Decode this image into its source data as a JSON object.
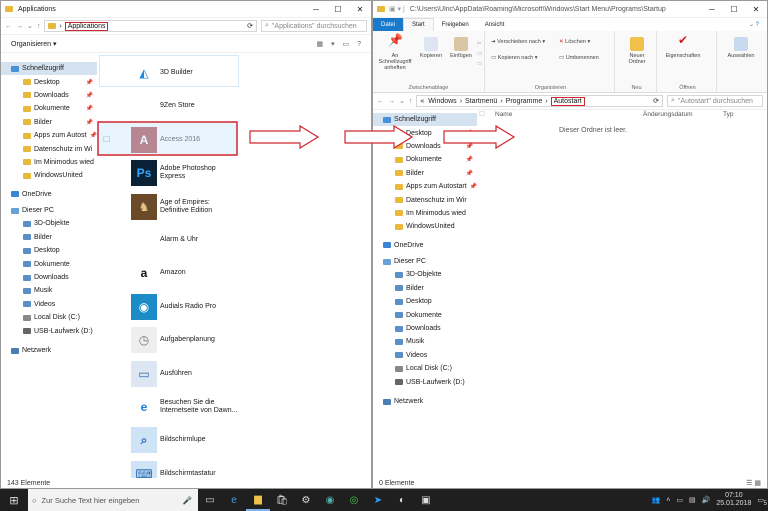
{
  "left_window": {
    "title": "Applications",
    "address": "Applications",
    "search_placeholder": "\"Applications\" durchsuchen",
    "organize_label": "Organisieren",
    "status": "143 Elemente",
    "nav": [
      "Schnellzugriff",
      "Desktop",
      "Downloads",
      "Dokumente",
      "Bilder",
      "Apps zum Autost",
      "Datenschutz im Wi",
      "Im Minimodus wied",
      "WindowsUnited",
      "OneDrive",
      "Dieser PC",
      "3D-Objekte",
      "Bilder",
      "Desktop",
      "Dokumente",
      "Downloads",
      "Musik",
      "Videos",
      "Local Disk (C:)",
      "USB-Laufwerk (D:)",
      "Netzwerk"
    ],
    "apps": [
      {
        "line1": "3D Builder",
        "line2": ""
      },
      {
        "line1": "9Zen Store",
        "line2": ""
      },
      {
        "line1": "Access 2016",
        "line2": ""
      },
      {
        "line1": "Adobe Photoshop",
        "line2": "Express"
      },
      {
        "line1": "Age of Empires:",
        "line2": "Definitive Edition"
      },
      {
        "line1": "Alarm & Uhr",
        "line2": ""
      },
      {
        "line1": "Amazon",
        "line2": ""
      },
      {
        "line1": "Audials Radio Pro",
        "line2": ""
      },
      {
        "line1": "Aufgabenplanung",
        "line2": ""
      },
      {
        "line1": "Ausführen",
        "line2": ""
      },
      {
        "line1": "Besuchen Sie die",
        "line2": "Internetseite von Dawn..."
      },
      {
        "line1": "Bildschirmlupe",
        "line2": ""
      },
      {
        "line1": "Bildschirmtastatur",
        "line2": ""
      }
    ]
  },
  "right_window": {
    "title_path": "C:\\Users\\Ulric\\AppData\\Roaming\\Microsoft\\Windows\\Start Menu\\Programs\\Startup",
    "tabs": [
      "Datei",
      "Start",
      "Freigeben",
      "Ansicht"
    ],
    "ribbon": {
      "pin": "An Schnellzugriff anheften",
      "copy": "Kopieren",
      "paste": "Einfügen",
      "clipboard_group": "Zwischenablage",
      "move_to": "Verschieben nach",
      "copy_to": "Kopieren nach",
      "delete": "Löschen",
      "rename": "Umbenennen",
      "organize_group": "Organisieren",
      "new_folder": "Neuer Ordner",
      "new_group": "Neu",
      "properties": "Eigenschaften",
      "open_group": "Öffnen",
      "select": "Auswählen"
    },
    "breadcrumb": [
      "Windows",
      "Startmenü",
      "Programme",
      "Autostart"
    ],
    "search_placeholder": "\"Autostart\" durchsuchen",
    "columns": [
      "Name",
      "Änderungsdatum",
      "Typ"
    ],
    "empty_message": "Dieser Ordner ist leer.",
    "status": "0 Elemente",
    "nav": [
      "Schnellzugriff",
      "Desktop",
      "Downloads",
      "Dokumente",
      "Bilder",
      "Apps zum Autostart",
      "Datenschutz im Wir",
      "Im Minimodus wied",
      "WindowsUnited",
      "OneDrive",
      "Dieser PC",
      "3D-Objekte",
      "Bilder",
      "Desktop",
      "Dokumente",
      "Downloads",
      "Musik",
      "Videos",
      "Local Disk (C:)",
      "USB-Laufwerk (D:)",
      "Netzwerk"
    ]
  },
  "taskbar": {
    "search_placeholder": "Zur Suche Text hier eingeben",
    "time": "07:10",
    "date": "25.01.2018",
    "notification_count": "5"
  },
  "colors": {
    "highlight": "#d0262f",
    "selection": "#cce8ff",
    "accent": "#1979ca"
  }
}
